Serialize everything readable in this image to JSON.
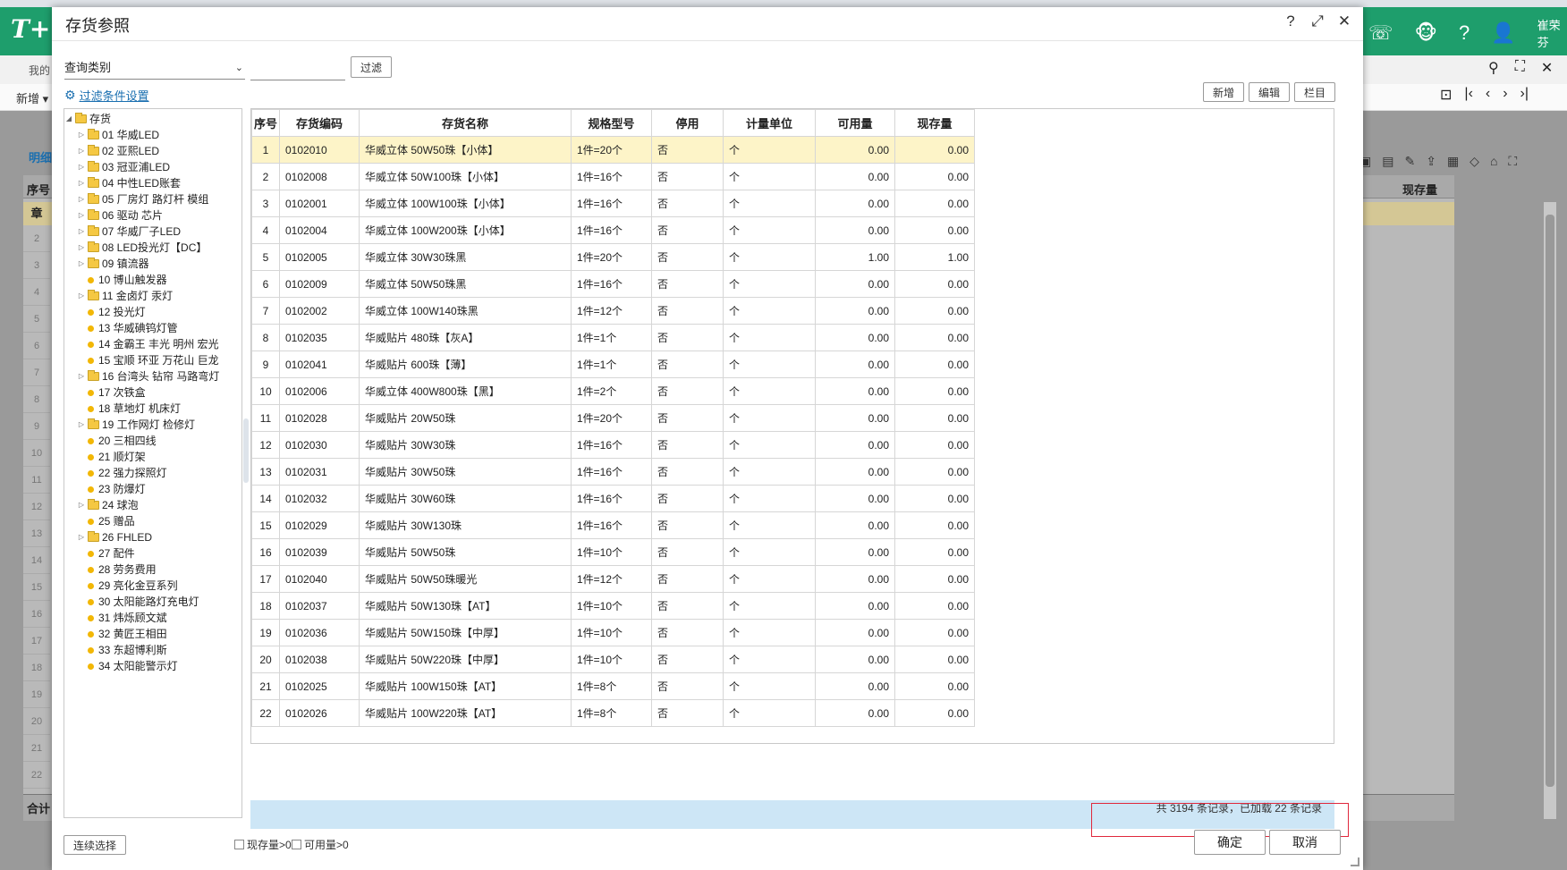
{
  "background": {
    "logo": "T+",
    "my_tab": "我的",
    "new_menu": "新增",
    "detail_tab": "明细",
    "col_seq": "序号",
    "col_qty": "现存量",
    "row1_badge": "章",
    "row_numbers": [
      "2",
      "3",
      "4",
      "5",
      "6",
      "7",
      "8",
      "9",
      "10",
      "11",
      "12",
      "13",
      "14",
      "15",
      "16",
      "17",
      "18",
      "19",
      "20",
      "21",
      "22"
    ],
    "sum_label": "合计",
    "user": "崔荣芬"
  },
  "dialog": {
    "title": "存货参照",
    "query_type": "查询类别",
    "filter_input": "",
    "filter_btn": "过滤",
    "cond_link": "过滤条件设置",
    "btn_add": "新增",
    "btn_edit": "编辑",
    "btn_cols": "栏目",
    "tree_root": "存货",
    "tree": [
      {
        "label": "01 华威LED",
        "folder": true
      },
      {
        "label": "02 亚熙LED",
        "folder": true
      },
      {
        "label": "03 冠亚浦LED",
        "folder": true
      },
      {
        "label": "04 中性LED账套",
        "folder": true
      },
      {
        "label": "05 厂房灯 路灯杆 模组",
        "folder": true
      },
      {
        "label": "06 驱动 芯片",
        "folder": true
      },
      {
        "label": "07 华威厂子LED",
        "folder": true
      },
      {
        "label": "08 LED投光灯【DC】",
        "folder": true
      },
      {
        "label": "09 镇流器",
        "folder": true
      },
      {
        "label": "10 博山触发器",
        "folder": false
      },
      {
        "label": "11 金卤灯 汞灯",
        "folder": true
      },
      {
        "label": "12 投光灯",
        "folder": false
      },
      {
        "label": "13 华威碘钨灯管",
        "folder": false
      },
      {
        "label": "14 金霸王 丰光 明州 宏光",
        "folder": false
      },
      {
        "label": "15 宝顺 环亚 万花山 巨龙",
        "folder": false
      },
      {
        "label": "16 台湾头 钻帘 马路弯灯",
        "folder": true
      },
      {
        "label": "17 次铁盒",
        "folder": false
      },
      {
        "label": "18 草地灯 机床灯",
        "folder": false
      },
      {
        "label": "19 工作网灯 检修灯",
        "folder": true
      },
      {
        "label": "20 三相四线",
        "folder": false
      },
      {
        "label": "21 顺灯架",
        "folder": false
      },
      {
        "label": "22 强力探照灯",
        "folder": false
      },
      {
        "label": "23 防爆灯",
        "folder": false
      },
      {
        "label": "24 球泡",
        "folder": true
      },
      {
        "label": "25 赠品",
        "folder": false
      },
      {
        "label": "26 FHLED",
        "folder": true
      },
      {
        "label": "27 配件",
        "folder": false
      },
      {
        "label": "28 劳务费用",
        "folder": false
      },
      {
        "label": "29 亮化金豆系列",
        "folder": false
      },
      {
        "label": "30 太阳能路灯充电灯",
        "folder": false
      },
      {
        "label": "31 炜烁顾文斌",
        "folder": false
      },
      {
        "label": "32 黄匠王相田",
        "folder": false
      },
      {
        "label": "33 东超博利斯",
        "folder": false
      },
      {
        "label": "34 太阳能警示灯",
        "folder": false
      }
    ],
    "columns": [
      "序号",
      "存货编码",
      "存货名称",
      "规格型号",
      "停用",
      "计量单位",
      "可用量",
      "现存量"
    ],
    "rows": [
      [
        "1",
        "0102010",
        "华威立体 50W50珠【小体】",
        "1件=20个",
        "否",
        "个",
        "0.00",
        "0.00"
      ],
      [
        "2",
        "0102008",
        "华威立体 50W100珠【小体】",
        "1件=16个",
        "否",
        "个",
        "0.00",
        "0.00"
      ],
      [
        "3",
        "0102001",
        "华威立体 100W100珠【小体】",
        "1件=16个",
        "否",
        "个",
        "0.00",
        "0.00"
      ],
      [
        "4",
        "0102004",
        "华威立体 100W200珠【小体】",
        "1件=16个",
        "否",
        "个",
        "0.00",
        "0.00"
      ],
      [
        "5",
        "0102005",
        "华威立体 30W30珠黑",
        "1件=20个",
        "否",
        "个",
        "1.00",
        "1.00"
      ],
      [
        "6",
        "0102009",
        "华威立体 50W50珠黑",
        "1件=16个",
        "否",
        "个",
        "0.00",
        "0.00"
      ],
      [
        "7",
        "0102002",
        "华威立体 100W140珠黑",
        "1件=12个",
        "否",
        "个",
        "0.00",
        "0.00"
      ],
      [
        "8",
        "0102035",
        "华威贴片 480珠【灰A】",
        "1件=1个",
        "否",
        "个",
        "0.00",
        "0.00"
      ],
      [
        "9",
        "0102041",
        "华威贴片 600珠【薄】",
        "1件=1个",
        "否",
        "个",
        "0.00",
        "0.00"
      ],
      [
        "10",
        "0102006",
        "华威立体 400W800珠【黑】",
        "1件=2个",
        "否",
        "个",
        "0.00",
        "0.00"
      ],
      [
        "11",
        "0102028",
        "华威贴片 20W50珠",
        "1件=20个",
        "否",
        "个",
        "0.00",
        "0.00"
      ],
      [
        "12",
        "0102030",
        "华威贴片 30W30珠",
        "1件=16个",
        "否",
        "个",
        "0.00",
        "0.00"
      ],
      [
        "13",
        "0102031",
        "华威贴片 30W50珠",
        "1件=16个",
        "否",
        "个",
        "0.00",
        "0.00"
      ],
      [
        "14",
        "0102032",
        "华威贴片 30W60珠",
        "1件=16个",
        "否",
        "个",
        "0.00",
        "0.00"
      ],
      [
        "15",
        "0102029",
        "华威贴片 30W130珠",
        "1件=16个",
        "否",
        "个",
        "0.00",
        "0.00"
      ],
      [
        "16",
        "0102039",
        "华威贴片 50W50珠",
        "1件=10个",
        "否",
        "个",
        "0.00",
        "0.00"
      ],
      [
        "17",
        "0102040",
        "华威贴片 50W50珠暖光",
        "1件=12个",
        "否",
        "个",
        "0.00",
        "0.00"
      ],
      [
        "18",
        "0102037",
        "华威贴片 50W130珠【AT】",
        "1件=10个",
        "否",
        "个",
        "0.00",
        "0.00"
      ],
      [
        "19",
        "0102036",
        "华威贴片 50W150珠【中厚】",
        "1件=10个",
        "否",
        "个",
        "0.00",
        "0.00"
      ],
      [
        "20",
        "0102038",
        "华威贴片 50W220珠【中厚】",
        "1件=10个",
        "否",
        "个",
        "0.00",
        "0.00"
      ],
      [
        "21",
        "0102025",
        "华威贴片 100W150珠【AT】",
        "1件=8个",
        "否",
        "个",
        "0.00",
        "0.00"
      ],
      [
        "22",
        "0102026",
        "华威贴片 100W220珠【AT】",
        "1件=8个",
        "否",
        "个",
        "0.00",
        "0.00"
      ]
    ],
    "status": "共 3194 条记录，已加载 22 条记录",
    "btn_continuous": "连续选择",
    "chk_stock": "现存量>0",
    "chk_avail": "可用量>0",
    "btn_ok": "确定",
    "btn_cancel": "取消"
  }
}
